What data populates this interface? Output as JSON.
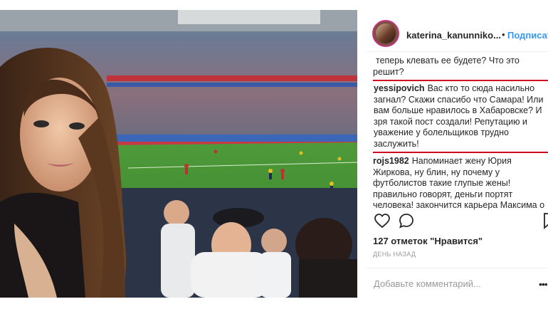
{
  "header": {
    "username": "katerina_kanunniko...",
    "separator": "•",
    "follow_label": "Подписат"
  },
  "comments": [
    {
      "user": "",
      "text": "теперь клевать ее будете?  Что это решит?"
    },
    {
      "user": "yessipovich",
      "text": "Вас кто то сюда насильно загнал? Скажи спасибо что Самара! Или вам больше нравилось в Хабаровске? И зря такой пост создали! Репутацию и уважение у болельщиков трудно заслужить!"
    },
    {
      "user": "rojs1982",
      "text": "Напоминает жену Юрия Жиркова, ну блин, ну почему у футболистов такие глупые жены! правильно говорят, деньги портят человека! закончится карьера Максима о"
    }
  ],
  "icons": [
    "heart-icon",
    "comment-icon",
    "bookmark-icon",
    "more-icon"
  ],
  "likes": "127 отметок \"Нравится\"",
  "time": "ДЕНЬ НАЗАД",
  "add_comment_placeholder": "Добавьте комментарий...",
  "highlight_color": "#d0021b",
  "accent_color": "#3897f0"
}
